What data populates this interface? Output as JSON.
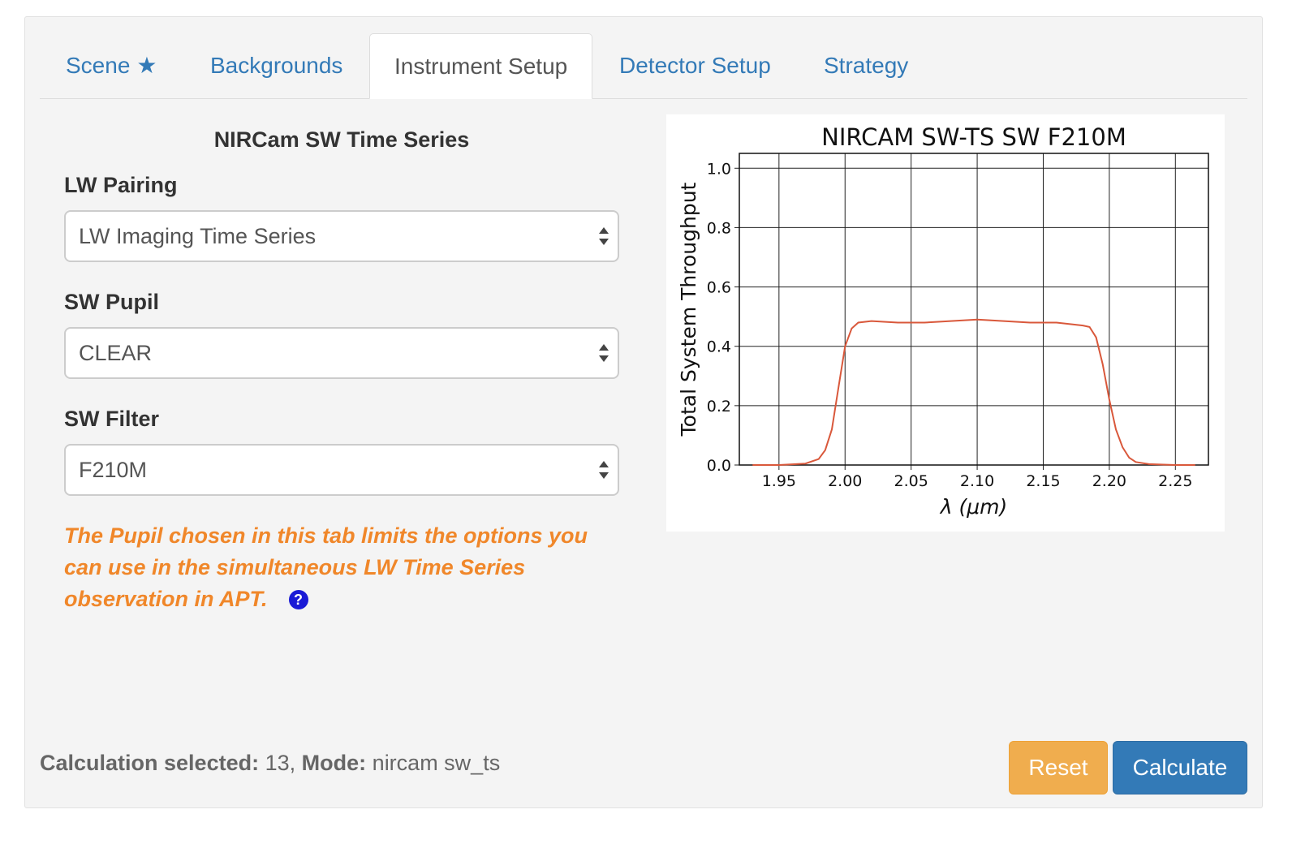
{
  "tabs": [
    {
      "label": "Scene",
      "icon": "star-icon",
      "active": false
    },
    {
      "label": "Backgrounds",
      "active": false
    },
    {
      "label": "Instrument Setup",
      "active": true
    },
    {
      "label": "Detector Setup",
      "active": false
    },
    {
      "label": "Strategy",
      "active": false
    }
  ],
  "form": {
    "title": "NIRCam SW Time Series",
    "lw_pairing": {
      "label": "LW Pairing",
      "value": "LW Imaging Time Series"
    },
    "sw_pupil": {
      "label": "SW Pupil",
      "value": "CLEAR"
    },
    "sw_filter": {
      "label": "SW Filter",
      "value": "F210M"
    },
    "note": "The Pupil chosen in this tab limits the options you can use in the simultaneous LW Time Series observation in APT.",
    "help_icon": "question-circle-icon"
  },
  "footer": {
    "calc_label": "Calculation selected:",
    "calc_value": "13,",
    "mode_label": "Mode:",
    "mode_value": "nircam sw_ts",
    "reset_label": "Reset",
    "calculate_label": "Calculate"
  },
  "colors": {
    "link": "#337ab7",
    "note": "#f0872a",
    "curve": "#d9583b",
    "reset": "#f0ad4e",
    "calculate": "#337ab7"
  },
  "chart_data": {
    "type": "line",
    "title": "NIRCAM SW-TS SW F210M",
    "xlabel": "λ (μm)",
    "ylabel": "Total System Throughput",
    "xlim": [
      1.92,
      2.275
    ],
    "ylim": [
      0.0,
      1.05
    ],
    "xticks": [
      1.95,
      2.0,
      2.05,
      2.1,
      2.15,
      2.2,
      2.25
    ],
    "xtick_labels": [
      "1.95",
      "2.00",
      "2.05",
      "2.10",
      "2.15",
      "2.20",
      "2.25"
    ],
    "yticks": [
      0.0,
      0.2,
      0.4,
      0.6,
      0.8,
      1.0
    ],
    "ytick_labels": [
      "0.0",
      "0.2",
      "0.4",
      "0.6",
      "0.8",
      "1.0"
    ],
    "grid": true,
    "series": [
      {
        "color": "#d9583b",
        "x": [
          1.93,
          1.95,
          1.97,
          1.98,
          1.985,
          1.99,
          1.995,
          2.0,
          2.005,
          2.01,
          2.02,
          2.04,
          2.06,
          2.08,
          2.1,
          2.12,
          2.14,
          2.16,
          2.18,
          2.185,
          2.19,
          2.195,
          2.2,
          2.205,
          2.21,
          2.215,
          2.22,
          2.23,
          2.25,
          2.265
        ],
        "y": [
          0.0,
          0.0,
          0.005,
          0.02,
          0.05,
          0.12,
          0.26,
          0.4,
          0.46,
          0.48,
          0.485,
          0.48,
          0.48,
          0.485,
          0.49,
          0.485,
          0.48,
          0.48,
          0.47,
          0.465,
          0.43,
          0.34,
          0.22,
          0.12,
          0.06,
          0.025,
          0.01,
          0.003,
          0.0,
          0.0
        ]
      }
    ]
  }
}
